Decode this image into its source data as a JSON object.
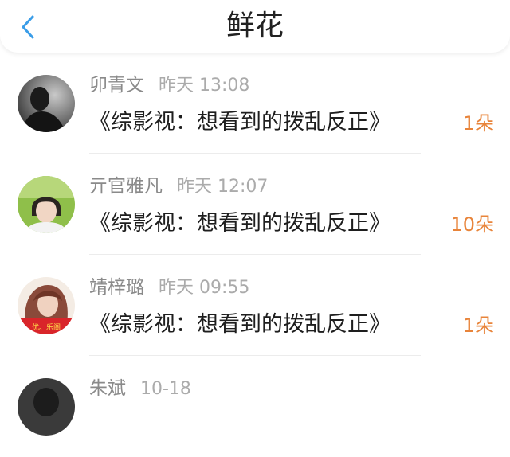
{
  "header": {
    "title": "鲜花",
    "back_icon": "chevron-left-icon",
    "accent": "#3a9de8"
  },
  "items": [
    {
      "name": "卯青文",
      "time": "昨天 13:08",
      "work": "《综影视：想看到的拨乱反正》",
      "count": "1朵"
    },
    {
      "name": "亓官雅凡",
      "time": "昨天 12:07",
      "work": "《综影视：想看到的拨乱反正》",
      "count": "10朵"
    },
    {
      "name": "靖梓璐",
      "time": "昨天 09:55",
      "work": "《综影视：想看到的拨乱反正》",
      "count": "1朵"
    },
    {
      "name": "朱斌",
      "time": "10-18",
      "work": "",
      "count": ""
    }
  ],
  "colors": {
    "count": "#e8843a",
    "name": "#8a8a8a",
    "work": "#1e1e1e"
  }
}
